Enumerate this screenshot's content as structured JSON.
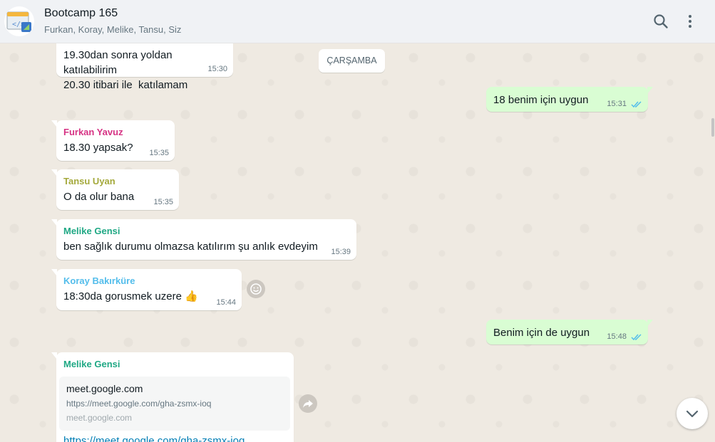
{
  "header": {
    "title": "Bootcamp 165",
    "members": "Furkan, Koray, Melike, Tansu, Siz",
    "search_icon": "search-icon",
    "menu_icon": "kebab-menu-icon"
  },
  "chat": {
    "date_separator": "ÇARŞAMBA",
    "messages": [
      {
        "text": "19.30dan sonra yoldan katılabilirim\n20.30 itibari ile  katılamam",
        "time": "15:30"
      },
      {
        "text": "18 benim için uygun",
        "time": "15:31",
        "status": "read"
      },
      {
        "sender": "Furkan Yavuz",
        "sender_color": "#d63384",
        "text": "18.30 yapsak?",
        "time": "15:35"
      },
      {
        "sender": "Tansu Uyan",
        "sender_color": "#a4a93b",
        "text": "O da olur bana",
        "time": "15:35"
      },
      {
        "sender": "Melike Gensi",
        "sender_color": "#1fa884",
        "text": "ben sağlık durumu olmazsa katılırım şu anlık evdeyim",
        "time": "15:39"
      },
      {
        "sender": "Koray Bakırküre",
        "sender_color": "#53bdeb",
        "text": "18:30da gorusmek uzere 👍",
        "time": "15:44"
      },
      {
        "text": "Benim için de uygun",
        "time": "15:48",
        "status": "read"
      },
      {
        "sender": "Melike Gensi",
        "sender_color": "#1fa884",
        "link_preview": {
          "title": "meet.google.com",
          "url": "https://meet.google.com/gha-zsmx-ioq",
          "domain": "meet.google.com"
        },
        "link_text": "https://meet.google.com/gha-zsmx-ioq"
      }
    ]
  },
  "colors": {
    "outgoing_bubble": "#d9fdd3",
    "incoming_bubble": "#ffffff",
    "read_ticks": "#53bdeb",
    "chat_background": "#efeae2"
  }
}
